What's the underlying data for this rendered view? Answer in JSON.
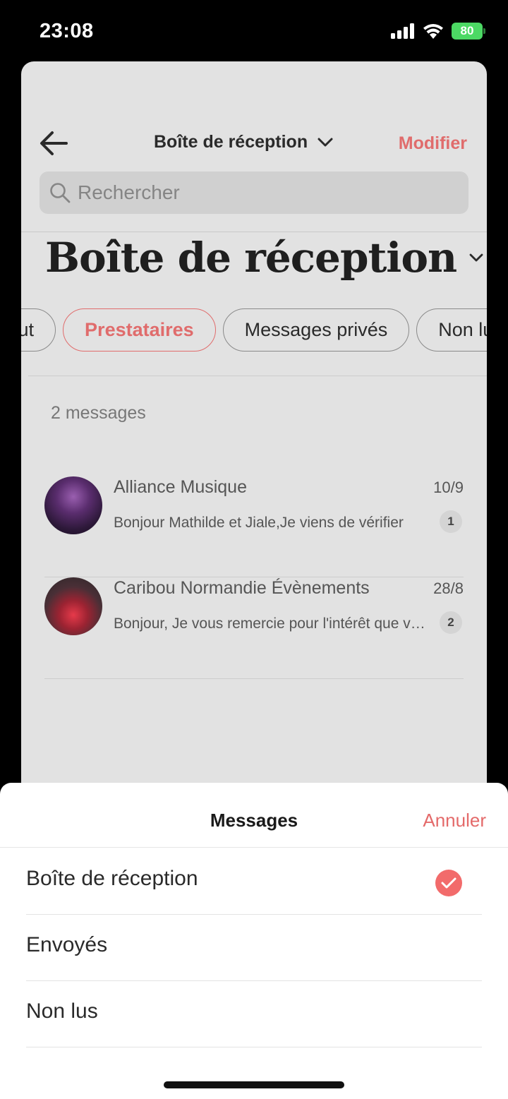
{
  "status_bar": {
    "time": "23:08",
    "battery": "80"
  },
  "nav": {
    "title": "Boîte de réception",
    "edit_label": "Modifier"
  },
  "search": {
    "placeholder": "Rechercher"
  },
  "page": {
    "title": "Boîte de réception"
  },
  "filters": [
    {
      "label": "Tout",
      "active": false
    },
    {
      "label": "Prestataires",
      "active": true
    },
    {
      "label": "Messages privés",
      "active": false
    },
    {
      "label": "Non lus",
      "active": false
    }
  ],
  "message_count": "2 messages",
  "messages": [
    {
      "name": "Alliance Musique",
      "date": "10/9",
      "preview": "Bonjour Mathilde et Jiale,Je viens de vérifier",
      "unread": "1"
    },
    {
      "name": "Caribou Normandie Évènements",
      "date": "28/8",
      "preview": "Bonjour, Je vous remercie pour l'intérêt que vous",
      "unread": "2"
    }
  ],
  "sheet": {
    "title": "Messages",
    "cancel_label": "Annuler",
    "options": [
      {
        "label": "Boîte de réception",
        "selected": true
      },
      {
        "label": "Envoyés",
        "selected": false
      },
      {
        "label": "Non lus",
        "selected": false
      }
    ]
  },
  "colors": {
    "accent": "#e06c6c",
    "check": "#f26b6b",
    "battery": "#4cd964"
  }
}
